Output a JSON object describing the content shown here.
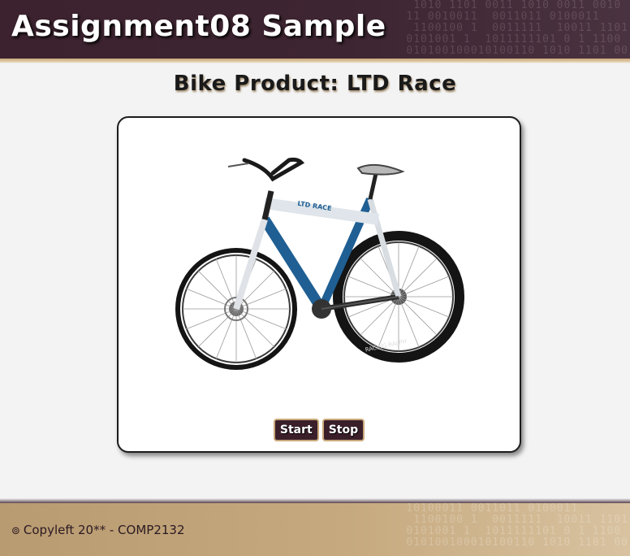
{
  "header": {
    "title": "Assignment08 Sample"
  },
  "product": {
    "title": "Bike Product: LTD Race"
  },
  "controls": {
    "start_label": "Start",
    "stop_label": "Stop"
  },
  "footer": {
    "copyright_symbol": "⊚",
    "copyright_text": "Copyleft 20** - COMP2132"
  },
  "bike": {
    "brand_text": "LTD RACE",
    "tyre_text": "RACING RALPH"
  },
  "colors": {
    "header_bg": "#3b222e",
    "accent": "#c9a97a",
    "button_bg": "#3a1f2b",
    "footer_bg": "#b99b71",
    "bike_blue": "#1f5f93"
  }
}
